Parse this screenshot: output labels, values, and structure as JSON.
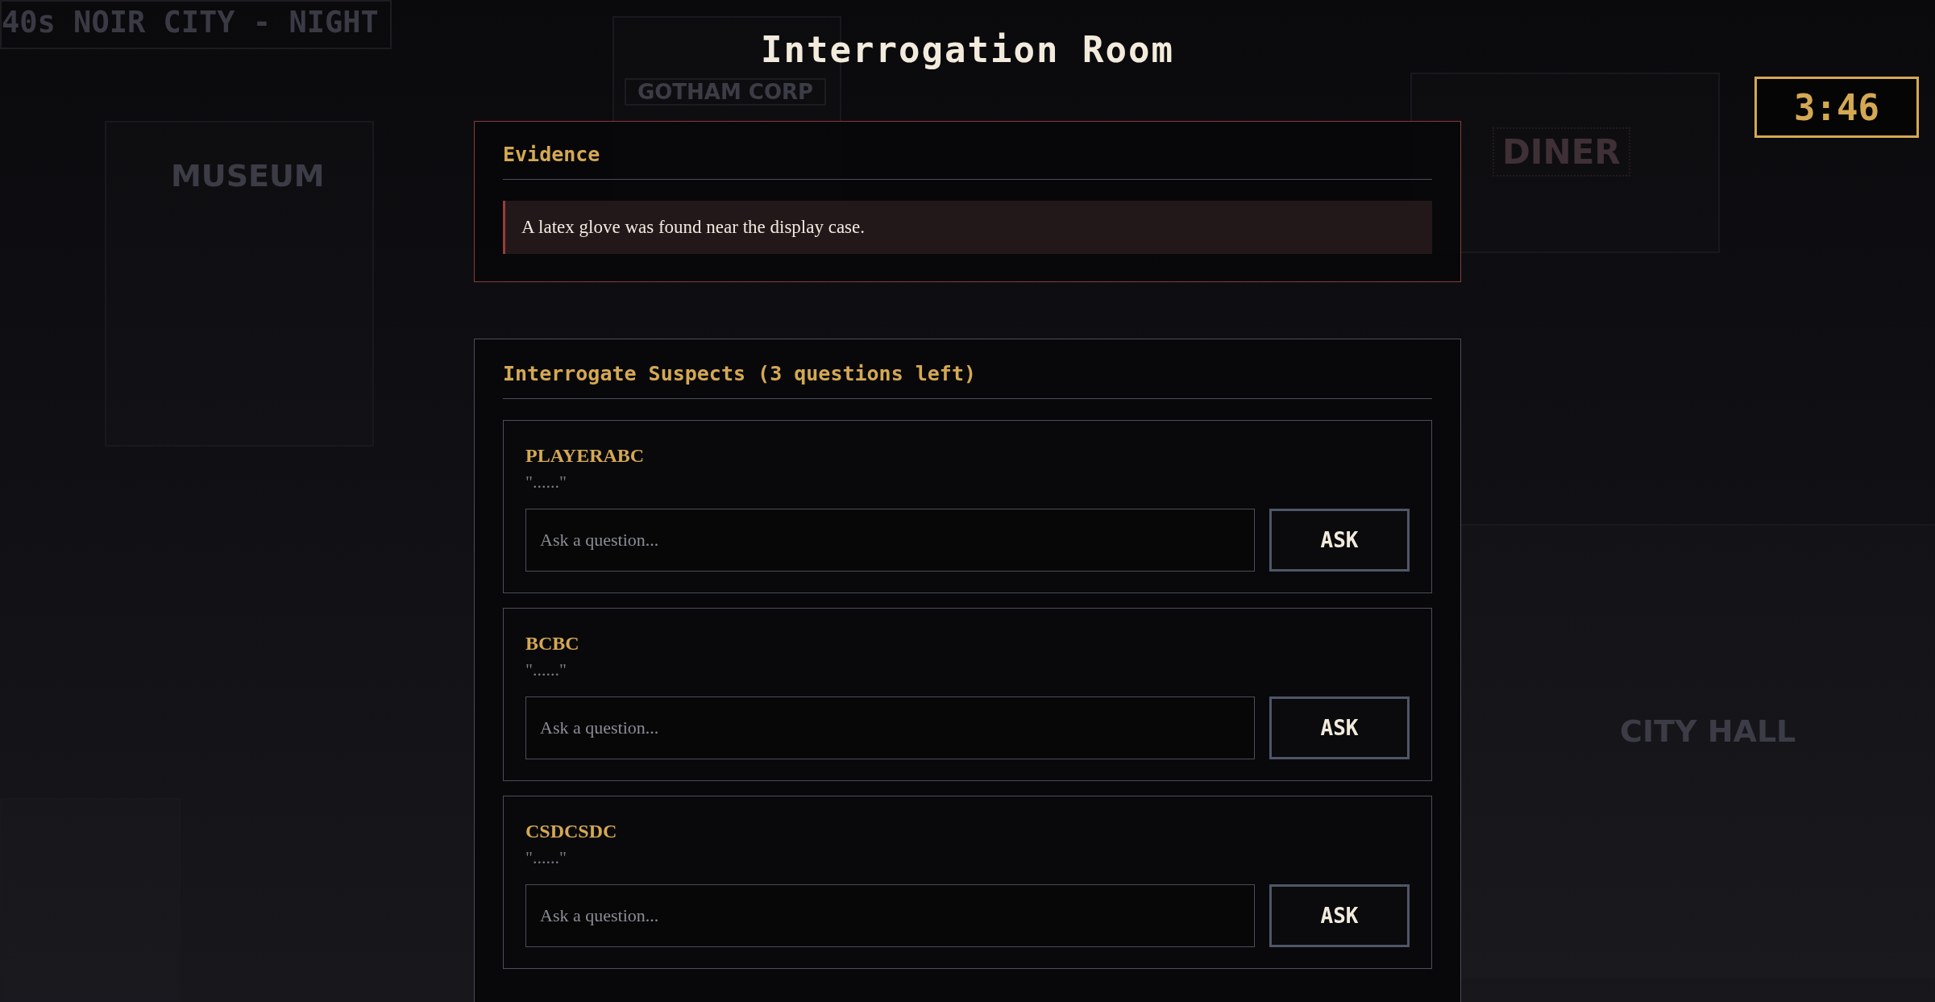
{
  "scene": {
    "banner": "40s NOIR CITY - NIGHT",
    "signs": [
      {
        "text": "MUSEUM",
        "kind": "plain"
      },
      {
        "text": "GOTHAM CORP",
        "kind": "boxed"
      },
      {
        "text": "DINER",
        "kind": "dotted"
      },
      {
        "text": "CITY HALL",
        "kind": "plain"
      }
    ]
  },
  "title": "Interrogation Room",
  "timer": "3:46",
  "evidence": {
    "heading": "Evidence",
    "items": [
      "A latex glove was found near the display case."
    ]
  },
  "interrogation": {
    "heading": "Interrogate Suspects (3 questions left)",
    "suspects": [
      {
        "name": "PLAYERABC",
        "reply": "\"......\"",
        "placeholder": "Ask a question...",
        "button": "ASK"
      },
      {
        "name": "BCBC",
        "reply": "\"......\"",
        "placeholder": "Ask a question...",
        "button": "ASK"
      },
      {
        "name": "CSDCSDC",
        "reply": "\"......\"",
        "placeholder": "Ask a question...",
        "button": "ASK"
      }
    ]
  }
}
